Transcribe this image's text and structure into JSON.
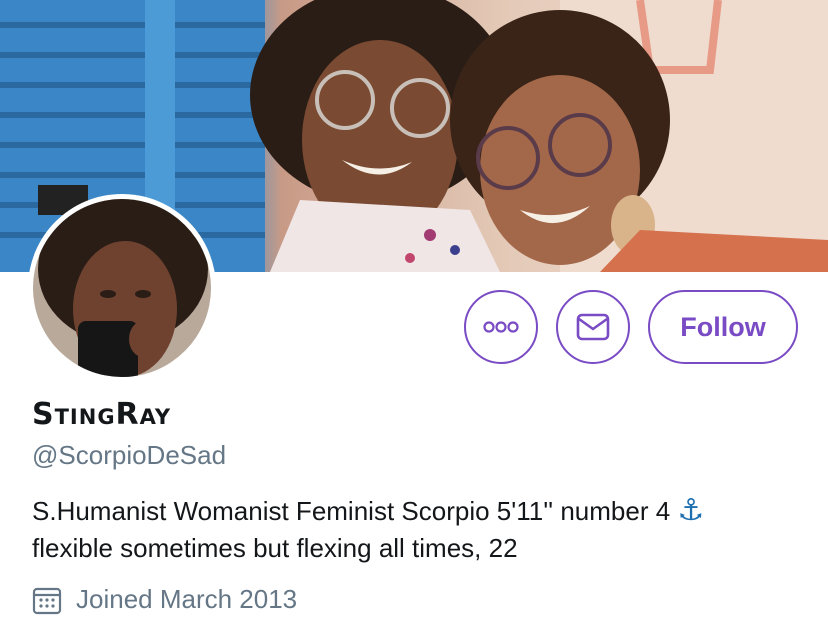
{
  "profile": {
    "display_name": "StingRay",
    "handle": "@ScorpioDeSad",
    "bio_line1": "S.Humanist Womanist Feminist Scorpio 5'11'' number 4",
    "bio_anchor": "⚓",
    "bio_line2": "flexible sometimes but flexing all times, 22",
    "joined": "Joined March 2013"
  },
  "actions": {
    "more_icon": "more-dots-icon",
    "message_icon": "envelope-icon",
    "follow_label": "Follow"
  },
  "colors": {
    "accent": "#794bc4",
    "secondary_text": "#657786",
    "primary_text": "#14171a"
  }
}
